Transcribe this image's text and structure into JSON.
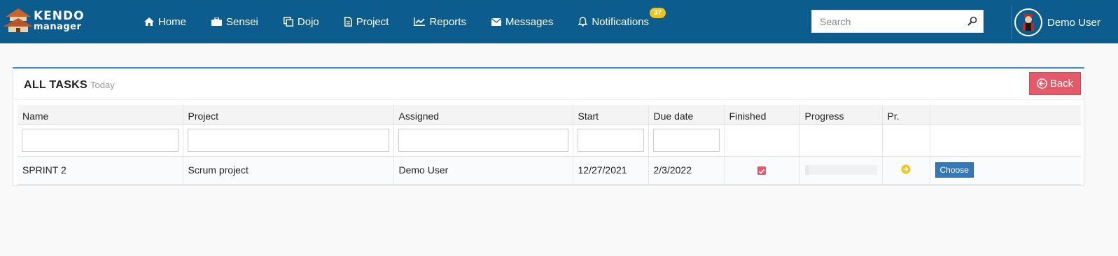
{
  "brand": {
    "line1": "KENDO",
    "line2": "manager"
  },
  "nav": [
    {
      "label": "Home",
      "icon": "home-icon"
    },
    {
      "label": "Sensei",
      "icon": "briefcase-icon"
    },
    {
      "label": "Dojo",
      "icon": "copy-icon"
    },
    {
      "label": "Project",
      "icon": "document-icon"
    },
    {
      "label": "Reports",
      "icon": "line-chart-icon"
    },
    {
      "label": "Messages",
      "icon": "envelope-icon"
    },
    {
      "label": "Notifications",
      "icon": "bell-icon",
      "badge": "37"
    }
  ],
  "search": {
    "placeholder": "Search",
    "value": ""
  },
  "user": {
    "name": "Demo User"
  },
  "panel": {
    "title": "ALL TASKS",
    "subtitle": "Today",
    "back_label": "Back"
  },
  "table": {
    "columns": [
      "Name",
      "Project",
      "Assigned",
      "Start",
      "Due date",
      "Finished",
      "Progress",
      "Pr.",
      ""
    ],
    "rows": [
      {
        "name": "SPRINT 2",
        "project": "Scrum project",
        "assigned": "Demo User",
        "start": "12/27/2021",
        "due": "2/3/2022",
        "finished": true,
        "progress": 0.05,
        "priority_icon": "arrow-circle-right-icon",
        "action_label": "Choose"
      }
    ]
  },
  "colors": {
    "topbar": "#0d5c8e",
    "accent": "#3c8ddc",
    "back_button": "#e35a6a",
    "badge": "#f0c419",
    "choose_button": "#3478b8"
  }
}
